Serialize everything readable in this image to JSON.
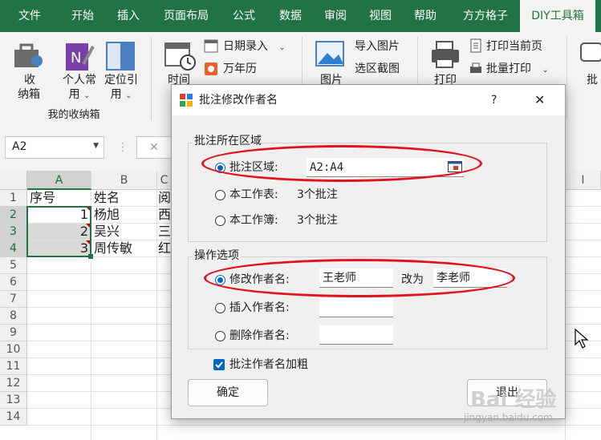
{
  "ribbon_tabs": [
    "文件",
    "开始",
    "插入",
    "页面布局",
    "公式",
    "数据",
    "审阅",
    "视图",
    "帮助",
    "方方格子",
    "DIY工具箱"
  ],
  "ribbon": {
    "btn_storage": "收\n纳箱",
    "storage_l1": "收",
    "storage_l2": "纳箱",
    "personal_l1": "个人常",
    "personal_l2": "用",
    "locate_l1": "定位引",
    "locate_l2": "用",
    "group_label": "我的收纳箱",
    "time_label": "时间",
    "date_entry": "日期录入",
    "calendar": "万年历",
    "picture_label": "图片",
    "import_pic": "导入图片",
    "area_screenshot": "选区截图",
    "print_label": "打印",
    "print_current": "打印当前页",
    "batch_print": "批量打印",
    "annot_label": "批"
  },
  "formula_bar": {
    "name_box": "A2"
  },
  "columns": [
    "A",
    "B",
    "C",
    "",
    "",
    "",
    "",
    "",
    "",
    "I"
  ],
  "rows": [
    "1",
    "2",
    "3",
    "4",
    "5",
    "6",
    "7",
    "8",
    "9",
    "10",
    "11",
    "12",
    "13",
    "14"
  ],
  "cells": {
    "A1": "序号",
    "B1": "姓名",
    "C1": "阅",
    "A2": "1",
    "B2": "杨旭",
    "C2": "西",
    "A3": "2",
    "B3": "吴兴",
    "C3": "三",
    "A4": "3",
    "B4": "周传敏",
    "C4": "红"
  },
  "dialog": {
    "title": "批注修改作者名",
    "help": "?",
    "close": "✕",
    "group1_title": "批注所在区域",
    "opt_area": "批注区域:",
    "area_value": "A2:A4",
    "opt_sheet": "本工作表:",
    "sheet_count": "3个批注",
    "opt_book": "本工作簿:",
    "book_count": "3个批注",
    "group2_title": "操作选项",
    "opt_modify": "修改作者名:",
    "modify_from": "王老师",
    "change_to": "改为",
    "modify_to": "李老师",
    "opt_insert": "插入作者名:",
    "opt_delete": "删除作者名:",
    "bold_author": "批注作者名加粗",
    "ok": "确定",
    "exit": "退出"
  },
  "watermark": {
    "line1": "Bai 经验",
    "line2": "jingyan.baidu.com"
  },
  "colors": {
    "accent": "#217346",
    "highlight": "#e0141e",
    "radio": "#0067c0"
  }
}
